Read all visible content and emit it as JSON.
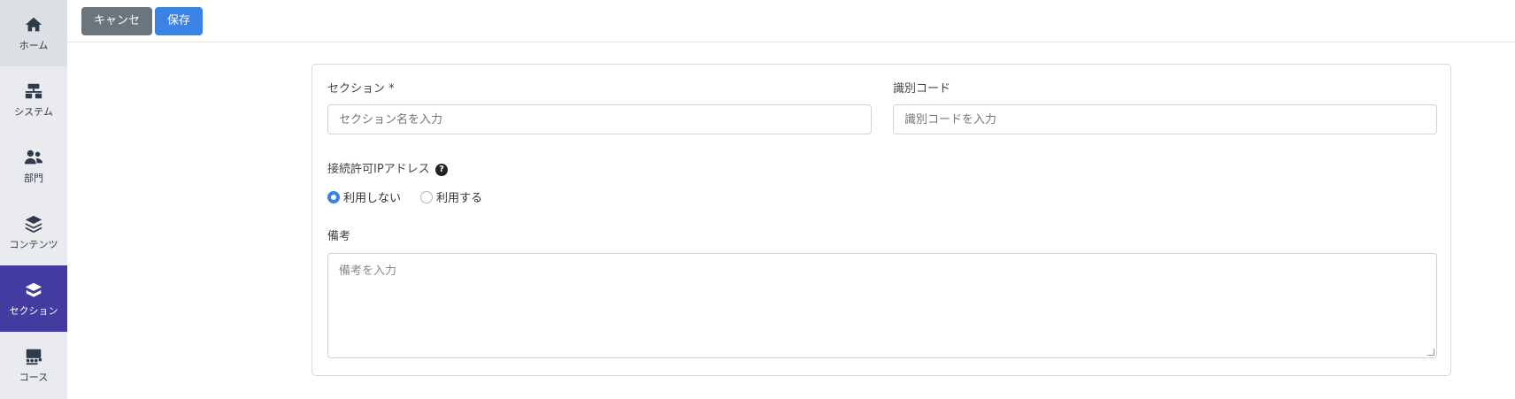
{
  "sidebar": {
    "items": [
      {
        "label": "ホーム",
        "icon": "home-icon"
      },
      {
        "label": "システム",
        "icon": "system-icon"
      },
      {
        "label": "部門",
        "icon": "users-icon"
      },
      {
        "label": "コンテンツ",
        "icon": "layers-icon"
      },
      {
        "label": "セクション",
        "icon": "section-icon"
      },
      {
        "label": "コース",
        "icon": "course-icon"
      }
    ],
    "active_index": 4,
    "active_color": "#443ba0"
  },
  "toolbar": {
    "cancel_label": "キャンセル",
    "save_label": "保存"
  },
  "form": {
    "section": {
      "label": "セクション *",
      "placeholder": "セクション名を入力",
      "value": ""
    },
    "code": {
      "label": "識別コード",
      "placeholder": "識別コードを入力",
      "value": ""
    },
    "ip": {
      "label": "接続許可IPアドレス",
      "help_icon": "question-circle-icon",
      "options": [
        "利用しない",
        "利用する"
      ],
      "selected": "利用しない"
    },
    "notes": {
      "label": "備考",
      "placeholder": "備考を入力",
      "value": ""
    }
  },
  "colors": {
    "primary": "#3b82e6",
    "secondary": "#6c757d"
  }
}
